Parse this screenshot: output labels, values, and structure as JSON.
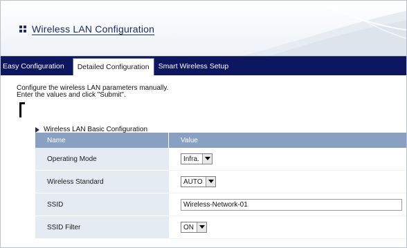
{
  "header": {
    "title": "Wireless LAN Configuration"
  },
  "tabs": [
    {
      "label": "Easy Configuration",
      "active": false
    },
    {
      "label": "Detailed Configuration",
      "active": true
    },
    {
      "label": "Smart Wireless Setup",
      "active": false
    }
  ],
  "description": {
    "line1": "Configure the wireless LAN parameters manually.",
    "line2": "Enter the values and click \"Submit\"."
  },
  "section": {
    "title": "Wireless LAN Basic Configuration",
    "columns": {
      "name": "Name",
      "value": "Value"
    },
    "rows": {
      "operating_mode": {
        "label": "Operating Mode",
        "value": "Infra."
      },
      "wireless_standard": {
        "label": "Wireless Standard",
        "value": "AUTO"
      },
      "ssid": {
        "label": "SSID",
        "value": "Wireless-Network-01"
      },
      "ssid_filter": {
        "label": "SSID Filter",
        "value": "ON"
      }
    }
  },
  "colors": {
    "tabbar": "#0d1760",
    "table_header": "#8aa0c2",
    "name_column": "#e5ebf3",
    "title": "#1d2b63"
  }
}
